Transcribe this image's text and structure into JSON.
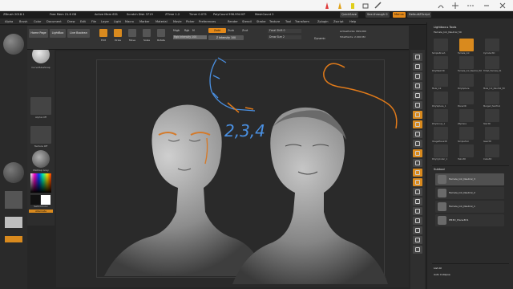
{
  "ink_toolbar": {
    "tools": [
      {
        "icon": "ballpoint-pen-icon",
        "color": "#e03a3a"
      },
      {
        "icon": "pencil-icon",
        "color": "#e0a21a"
      },
      {
        "icon": "highlighter-icon",
        "color": "#e0cf1a"
      },
      {
        "icon": "eraser-icon",
        "color": "#555555"
      },
      {
        "icon": "ruler-icon",
        "color": "#555555"
      },
      {
        "icon": "touch-writing-icon",
        "color": "#555555"
      },
      {
        "icon": "pan-icon",
        "color": "#555555"
      },
      {
        "icon": "more-icon",
        "color": "#555555"
      },
      {
        "icon": "minimize-icon",
        "color": "#555555"
      },
      {
        "icon": "close-icon",
        "color": "#555555"
      }
    ]
  },
  "titlebar": {
    "app": "ZBrush 2018.1",
    "texts": [
      "Free Mem 21.6 GB",
      "Active Mem 631",
      "Scratch Disk 3719",
      "ZTime 1.2",
      "Timer 0.075",
      "PolyCount 996.994 KP",
      "MeshCount 2"
    ],
    "quicksave": "QuickSave",
    "see_through": "See-through 0",
    "menus_btn": "Menus",
    "script": "DefaultZScript"
  },
  "menubar": {
    "items": [
      "Alpha",
      "Brush",
      "Color",
      "Document",
      "Draw",
      "Edit",
      "File",
      "Layer",
      "Light",
      "Macro",
      "Marker",
      "Material",
      "Movie",
      "Picker",
      "Preferences",
      "Render",
      "Stencil",
      "Stroke",
      "Texture",
      "Tool",
      "Transform",
      "Zplugin",
      "Zscript",
      "Help"
    ]
  },
  "shelf": {
    "home_page": "Home Page",
    "lightbox": "LightBox",
    "live_boolean": "Live Boolean",
    "tools": [
      "Edit",
      "Draw",
      "Move",
      "Scale",
      "Rotate"
    ],
    "mrgb": "Mrgb",
    "rgb": "Rgb",
    "m": "M",
    "zadd": "Zadd",
    "zsub": "Zsub",
    "zcut": "Zcut",
    "rgb_intensity": "Rgb Intensity 100",
    "z_intensity": "Z Intensity 100",
    "focal_shift": "Focal Shift 0",
    "draw_size": "Draw Size 2",
    "dynamic": "Dynamic",
    "active_points": "ActivePoints: 899,999",
    "total_points": "TotalPoints: 2.000 Mil"
  },
  "left_panel": {
    "items": [
      "CurveTubeSnap",
      "Alpha Off",
      "Texture Off",
      "MatCap Gray"
    ],
    "gradient": "Gradient",
    "switch_color": "SwitchColor",
    "alternate": "Alternate"
  },
  "right_strip": {
    "buttons": [
      "BPR",
      "SPix 3",
      "Scroll",
      "Zoom",
      "Actual",
      "AAHalf",
      "Persp",
      "Floor",
      "Local",
      "LSym",
      "Gxyz",
      "Frame",
      "Move",
      "Scale",
      "Rotate",
      "Line Fill",
      "PolyF",
      "Transp",
      "Dynamic",
      "Solo",
      "Xpose"
    ],
    "active_indices": [
      6,
      7,
      10,
      12,
      13
    ]
  },
  "right_panel": {
    "header": "Lightbox ▸ Tools",
    "tool_name": "Female_Ink_Neutral_50",
    "tools": [
      {
        "label": "SimpleBrush"
      },
      {
        "label": "Female_Ink"
      },
      {
        "label": "Cylinder3D"
      },
      {
        "label": "PolyMesh3D"
      },
      {
        "label": "Female_Ink_Neutral_50"
      },
      {
        "label": "TriSet_Female_01"
      },
      {
        "label": "Male_Ink"
      },
      {
        "label": "PolySphere"
      },
      {
        "label": "Male_Ink_Neutral_50"
      },
      {
        "label": "PolySphere_1"
      },
      {
        "label": "Plane3D"
      },
      {
        "label": "Merged_SubTool"
      },
      {
        "label": "PolyGroup_1"
      },
      {
        "label": "ZSphere"
      },
      {
        "label": "Star3D"
      },
      {
        "label": "ImagePlane3D"
      },
      {
        "label": "SimpleTool"
      },
      {
        "label": "Gear3D"
      },
      {
        "label": "PolyCylinder_1"
      },
      {
        "label": "Helix3D"
      },
      {
        "label": "Cube3D"
      }
    ],
    "subtool_header": "Subtool",
    "subtools": [
      {
        "label": "Female_Ink_Neutral_3",
        "selected": true
      },
      {
        "label": "Female_Ink_Neutral_2",
        "selected": false
      },
      {
        "label": "Female_Ink_Neutral_1",
        "selected": false
      },
      {
        "label": "PM3D_Plane3D1",
        "selected": false
      }
    ],
    "footer": [
      "List All",
      "Auto Collapse"
    ]
  },
  "annotation": {
    "text": "2,3,4",
    "stroke_color_blue": "#4a90e2",
    "stroke_color_orange": "#e07a1a"
  },
  "colors": {
    "accent": "#e58a1a",
    "background": "#262626"
  }
}
